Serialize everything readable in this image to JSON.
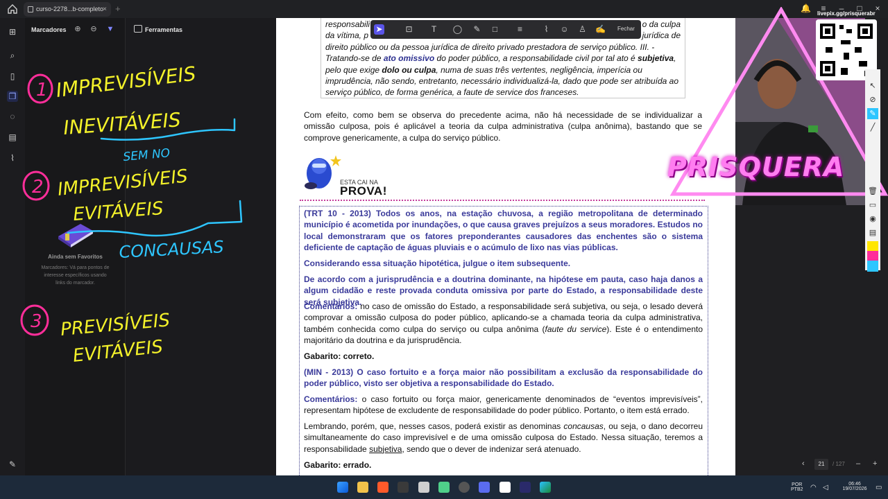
{
  "tab": {
    "title": "curso-2278...b-completo",
    "close": "×",
    "new": "+"
  },
  "panel": {
    "title": "Marcadores",
    "empty_title": "Ainda sem Favoritos",
    "empty_desc": "Marcadores: Vá para pontos de interesse específicos usando links do marcador.",
    "nav_more": "···"
  },
  "tools": {
    "title": "Ferramentas"
  },
  "ink": {
    "n1": "1",
    "w1a": "IMPREVISÍVEIS",
    "w1b": "INEVITÁVEIS",
    "w1c": "SEM NO",
    "n2": "2",
    "w2a": "IMPREVISÍVEIS",
    "w2b": "EVITÁVEIS",
    "w2c": "CONCAUSAS",
    "n3": "3",
    "w3a": "PREVISÍVEIS",
    "w3b": "EVITÁVEIS"
  },
  "annotation_toolbar": {
    "close_label": "Fechar"
  },
  "document": {
    "quote_l1": "responsabili",
    "quote_l1_end": "o da culpa",
    "quote_l2": "da vítima, p",
    "quote_l2_end": "jurídica de",
    "quote_l3": "direito público ou da pessoa jurídica de direito privado prestadora de serviço público. III. -",
    "quote_l4a": "Tratando-se de ",
    "quote_l4b": "ato omissivo",
    "quote_l4c": " do poder público, a responsabilidade civil por tal ato é ",
    "quote_l4d": "subjetiva",
    "quote_l4e": ",",
    "quote_l5a": "pelo que exige ",
    "quote_l5b": "dolo ou culpa",
    "quote_l5c": ", numa de suas três vertentes, negligência, imperícia ou",
    "quote_l6": "imprudência, não sendo, entretanto, necessário individualizá-la, dado que pode ser atribuída ao",
    "quote_l7": "serviço público, de forma genérica, a faute de service dos franceses.",
    "para1": "Com efeito, como bem se observa do precedente acima, não há necessidade de se individualizar a omissão culposa, pois é aplicável a teoria da culpa administrativa (culpa anônima), bastando que se comprove genericamente, a culpa do serviço público.",
    "prova_small": "ESTA CAI NA",
    "prova_big": "PROVA!",
    "q1": "(TRT 10 - 2013) Todos os anos, na estação chuvosa, a região metropolitana de determinado município é acometida por inundações, o que causa graves prejuízos a seus moradores. Estudos no local demonstraram que os fatores preponderantes causadores das enchentes são o sistema deficiente de captação de águas pluviais e o acúmulo de lixo nas vias públicas.",
    "q1b": "Considerando essa situação hipotética, julgue o item subsequente.",
    "q1c": "De acordo com a jurisprudência e a doutrina dominante, na hipótese em pauta, caso haja danos a algum cidadão e reste provada conduta omissiva por parte do Estado, a responsabilidade deste será subjetiva.",
    "com_label": "Comentários:",
    "c1a": " no caso de omissão do Estado, a responsabilidade será subjetiva, ou seja, o lesado deverá comprovar a omissão culposa do poder público, aplicando-se a chamada teoria da culpa administrativa, também conhecida como culpa do serviço ou culpa anônima (",
    "c1b": "faute du service",
    "c1c": "). Este é o entendimento majoritário da doutrina e da jurisprudência.",
    "gab1": "Gabarito: correto.",
    "q2": "(MIN - 2013) O caso fortuito e a força maior não possibilitam a exclusão da responsabilidade do poder público, visto ser objetiva a responsabilidade do Estado.",
    "c2": " o caso fortuito ou força maior, genericamente denominados de “eventos imprevisíveis”, representam hipótese de excludente de responsabilidade do poder público. Portanto, o item está errado.",
    "c3a": "Lembrando, porém, que, nesses casos, poderá existir as denominas ",
    "c3b": "concausas",
    "c3c": ", ou seja, o dano decorreu simultaneamente do caso imprevisível e de uma omissão culposa do Estado. Nessa situação, teremos a responsabilidade ",
    "c3d": "subjetiva",
    "c3e": ", sendo que o dever de indenizar será atenuado.",
    "gab2": "Gabarito: errado."
  },
  "pagination": {
    "current": "21",
    "total": "/ 127"
  },
  "stream": {
    "livepix": "livepix.gg/prisquerabr",
    "brand": "PRISQUERA"
  },
  "taskbar": {
    "lang1": "POR",
    "lang2": "PTB2",
    "time": "06:46",
    "date": "19/07/2026"
  },
  "colors": {
    "accent": "#5a54e8",
    "ink_yellow": "#f4f22a",
    "ink_pink": "#ff2e9a",
    "ink_blue": "#2ec6ff",
    "question_blue": "#3a3a9a"
  }
}
